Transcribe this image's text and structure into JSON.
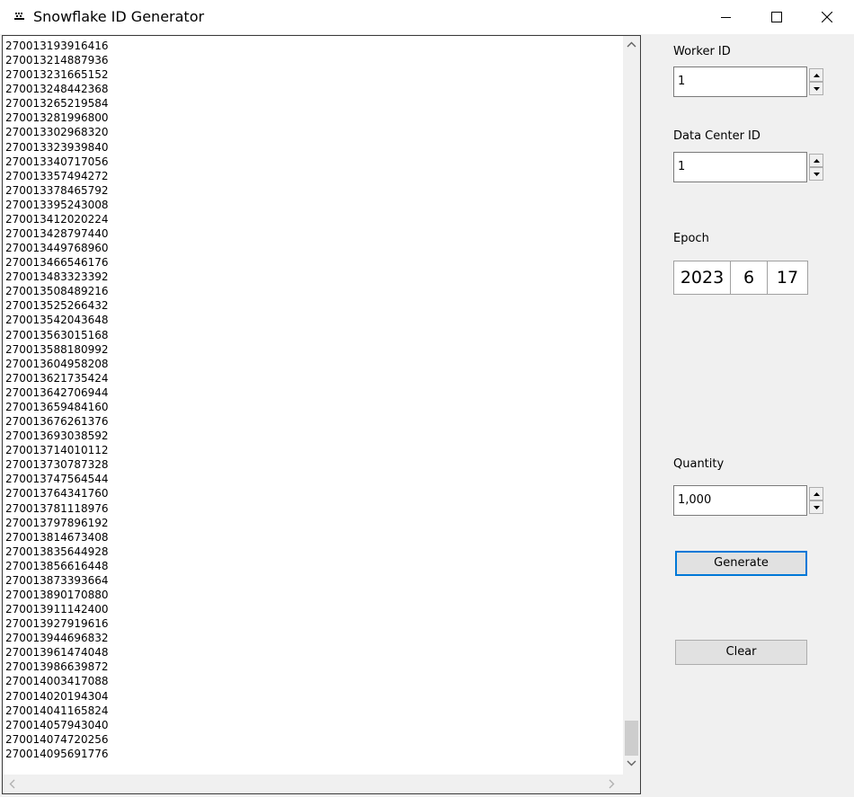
{
  "window": {
    "title": "Snowflake ID Generator",
    "icon": "snowflake-app-icon",
    "controls": [
      "minimize-icon",
      "maximize-icon",
      "close-icon"
    ]
  },
  "output": {
    "ids": [
      "270013193916416",
      "270013214887936",
      "270013231665152",
      "270013248442368",
      "270013265219584",
      "270013281996800",
      "270013302968320",
      "270013323939840",
      "270013340717056",
      "270013357494272",
      "270013378465792",
      "270013395243008",
      "270013412020224",
      "270013428797440",
      "270013449768960",
      "270013466546176",
      "270013483323392",
      "270013508489216",
      "270013525266432",
      "270013542043648",
      "270013563015168",
      "270013588180992",
      "270013604958208",
      "270013621735424",
      "270013642706944",
      "270013659484160",
      "270013676261376",
      "270013693038592",
      "270013714010112",
      "270013730787328",
      "270013747564544",
      "270013764341760",
      "270013781118976",
      "270013797896192",
      "270013814673408",
      "270013835644928",
      "270013856616448",
      "270013873393664",
      "270013890170880",
      "270013911142400",
      "270013927919616",
      "270013944696832",
      "270013961474048",
      "270013986639872",
      "270014003417088",
      "270014020194304",
      "270014041165824",
      "270014057943040",
      "270014074720256",
      "270014095691776"
    ]
  },
  "worker_id": {
    "label": "Worker ID",
    "value": "1"
  },
  "data_center_id": {
    "label": "Data Center ID",
    "value": "1"
  },
  "epoch": {
    "label": "Epoch",
    "year": "2023",
    "month": "6",
    "day": "17"
  },
  "quantity": {
    "label": "Quantity",
    "value": "1,000"
  },
  "actions": {
    "generate_label": "Generate",
    "clear_label": "Clear"
  },
  "colors": {
    "focus_accent": "#0078d7",
    "window_bg": "#f0f0f0"
  }
}
